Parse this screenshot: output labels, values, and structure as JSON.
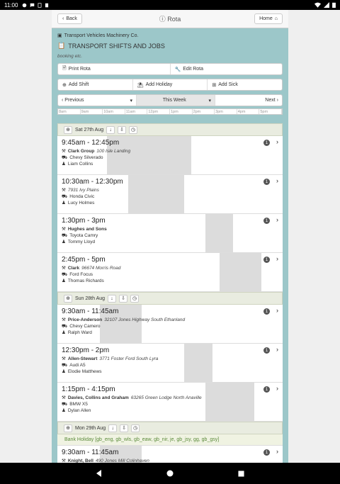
{
  "status": {
    "time": "11:00"
  },
  "topbar": {
    "back_label": "Back",
    "title": "Rota",
    "home_label": "Home"
  },
  "company": "Transport Vehicles Machinery Co.",
  "heading": "TRANSPORT SHIFTS AND JOBS",
  "subtext": "booking etc.",
  "actions1": {
    "print": "Print Rota",
    "edit": "Edit Rota"
  },
  "actions2": {
    "add_shift": "Add Shift",
    "add_holiday": "Add Holiday",
    "add_sick": "Add Sick"
  },
  "nav": {
    "prev": "Previous",
    "week": "This Week",
    "next": "Next"
  },
  "timeline": [
    "8am",
    "9am",
    "10am",
    "11am",
    "12pm",
    "1pm",
    "2pm",
    "3pm",
    "4pm",
    "5pm"
  ],
  "days": [
    {
      "label": "Sat 27th Aug",
      "jobs": [
        {
          "time": "9:45am - 12:45pm",
          "client": "Clark Group",
          "address": "100 Isle Landing",
          "vehicle": "Chevy Silverado",
          "driver": "Liam Collins",
          "count": "1",
          "band_start": 0.219,
          "band_end": 0.594
        },
        {
          "time": "10:30am - 12:30pm",
          "client": "",
          "address": "7931 Ivy Plains",
          "vehicle": "Honda Civic",
          "driver": "Lucy Holmes",
          "count": "1",
          "band_start": 0.313,
          "band_end": 0.563
        },
        {
          "time": "1:30pm - 3pm",
          "client": "Hughes and Sons",
          "address": "",
          "vehicle": "Toyota Camry",
          "driver": "Tommy Lloyd",
          "count": "1",
          "band_start": 0.656,
          "band_end": 0.781
        },
        {
          "time": "2:45pm - 5pm",
          "client": "Clark",
          "address": "96674 Morris Road",
          "vehicle": "Ford Focus",
          "driver": "Thomas Richards",
          "count": "1",
          "band_start": 0.719,
          "band_end": 0.906
        }
      ]
    },
    {
      "label": "Sun 28th Aug",
      "jobs": [
        {
          "time": "9:30am - 11:45am",
          "client": "Price-Anderson",
          "address": "32107 Jones Highway South Ethanland",
          "vehicle": "Chevy Camero",
          "driver": "Ralph Ward",
          "count": "1",
          "band_start": 0.188,
          "band_end": 0.375
        },
        {
          "time": "12:30pm - 2pm",
          "client": "Allen-Stewart",
          "address": "3771 Foster Ford South Lyra",
          "vehicle": "Audi A5",
          "driver": "Elodie Matthews",
          "count": "1",
          "band_start": 0.563,
          "band_end": 0.688
        },
        {
          "time": "1:15pm - 4:15pm",
          "client": "Davies, Collins and Graham",
          "address": "63265 Green Lodge North Anaville",
          "vehicle": "BMW X5",
          "driver": "Dylan Allen",
          "count": "1",
          "band_start": 0.656,
          "band_end": 0.875
        }
      ]
    },
    {
      "label": "Mon 29th Aug",
      "holiday": "Bank Holiday [gb_eng, gb_wls, gb_eaw, gb_nir, je, gb_jsy, gg, gb_gsy]",
      "jobs": [
        {
          "time": "9:30am - 11:45am",
          "client": "Knight, Bell",
          "address": "490 Jones Mill Colinhaven",
          "vehicle": "",
          "driver": "",
          "count": "1",
          "band_start": 0.188,
          "band_end": 0.375
        }
      ]
    }
  ]
}
